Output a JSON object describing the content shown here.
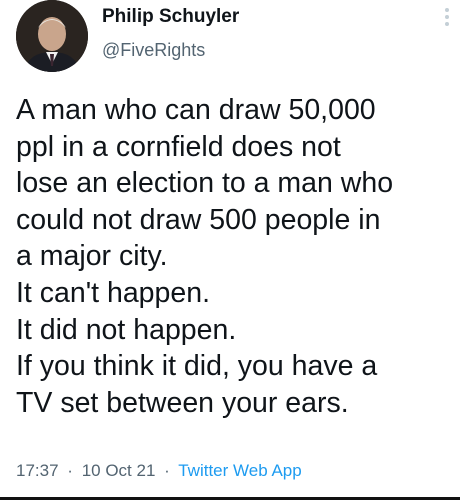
{
  "author": {
    "display_name": "Philip Schuyler",
    "handle": "@FiveRights",
    "avatar_icon": "profile-photo"
  },
  "tweet": {
    "lines": [
      "A man who can draw 50,000",
      "ppl in a cornfield does not",
      "lose an election to a man who",
      "could not draw 500 people in",
      "a major city.",
      "It can't happen.",
      "It did not happen.",
      "If you think it did, you have a",
      "TV set between your ears."
    ]
  },
  "meta": {
    "time": "17:37",
    "separator": "·",
    "date": "10 Oct 21",
    "source": "Twitter Web App"
  },
  "colors": {
    "text": "#0f1419",
    "secondary": "#536471",
    "link": "#1d9bf0"
  }
}
